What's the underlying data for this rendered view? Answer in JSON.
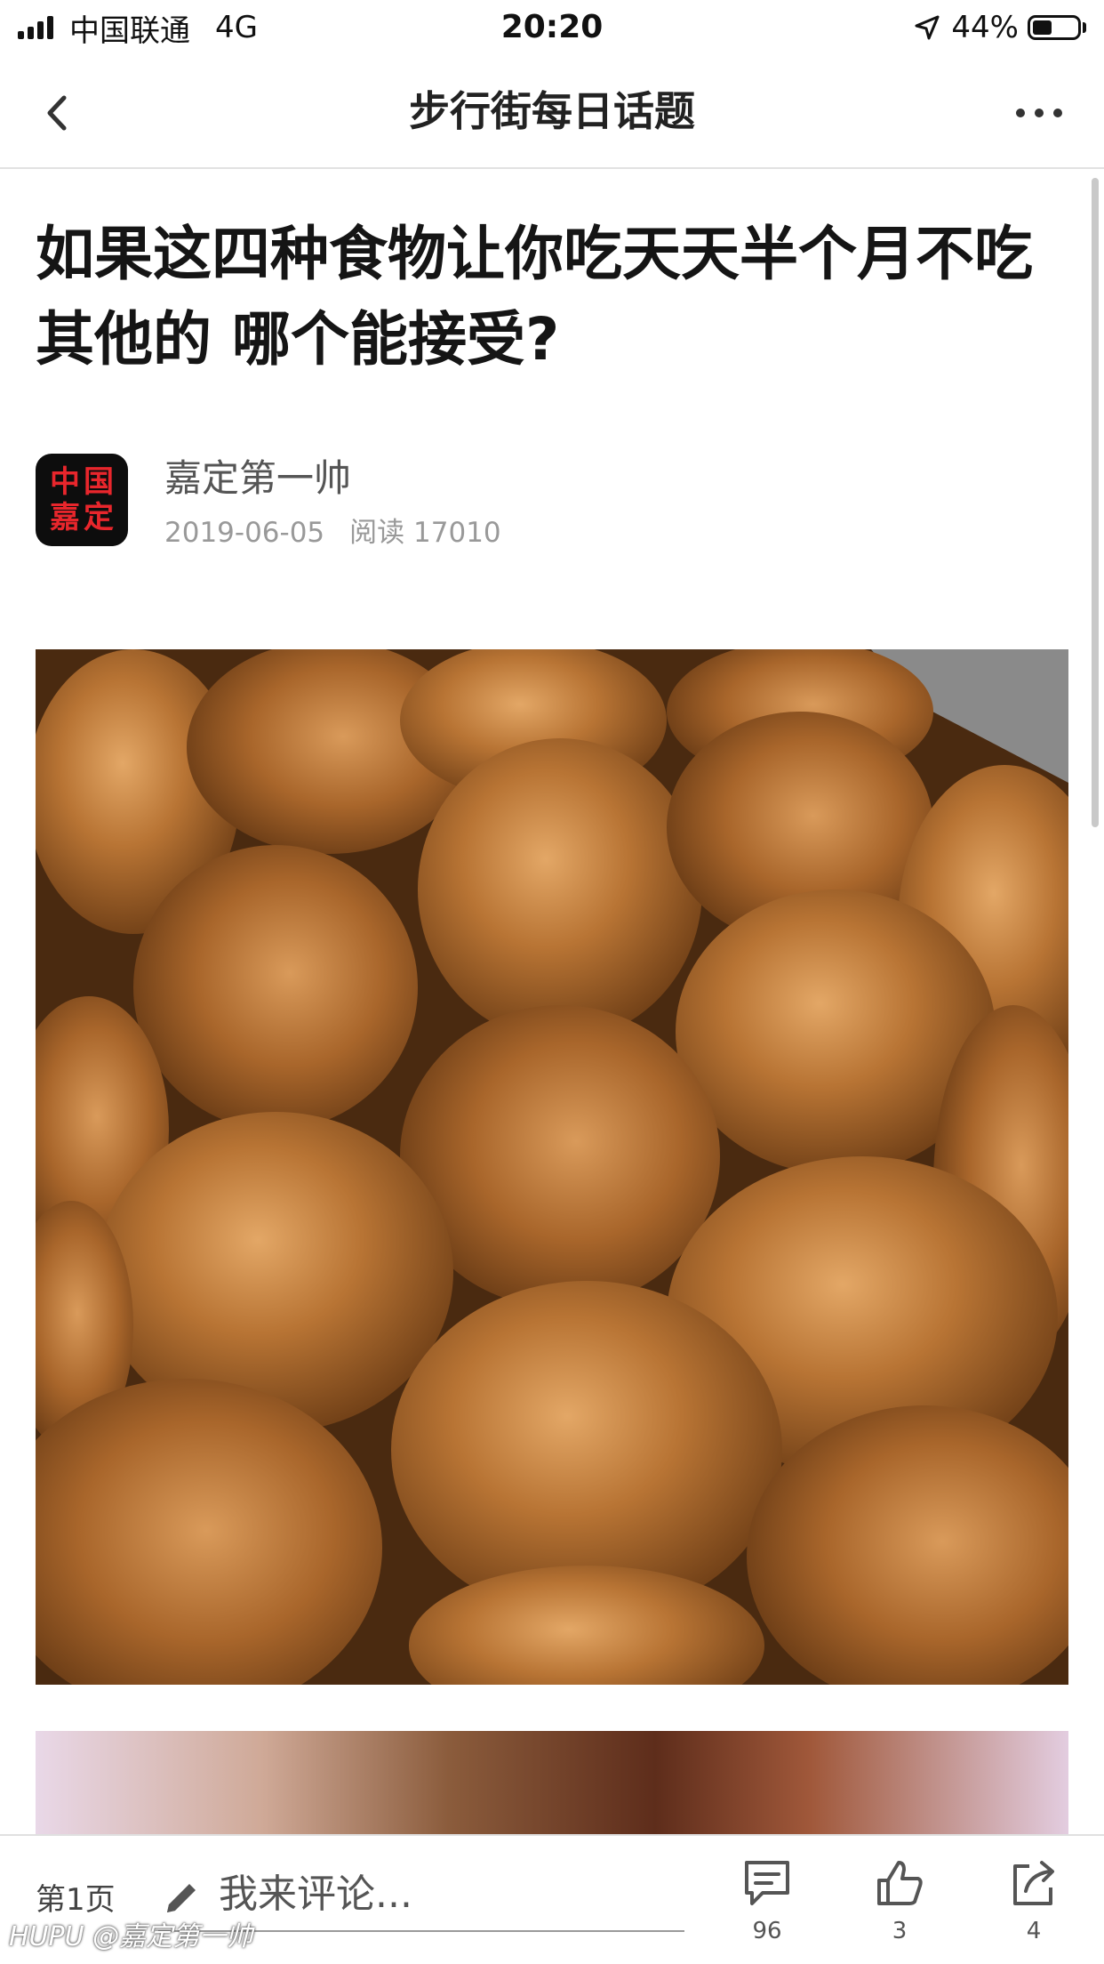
{
  "status_bar": {
    "carrier": "中国联通",
    "network": "4G",
    "time": "20:20",
    "battery_percent": "44%",
    "battery_level": 0.44
  },
  "nav": {
    "title": "步行街每日话题"
  },
  "article": {
    "title": "如果这四种食物让你吃天天半个月不吃其他的 哪个能接受?",
    "author": {
      "name": "嘉定第一帅",
      "avatar_text": [
        "中",
        "国",
        "嘉",
        "定"
      ],
      "date": "2019-06-05",
      "views": "阅读 17010"
    }
  },
  "bottom_bar": {
    "page_label": "第1页",
    "comment_placeholder": "我来评论...",
    "comment_count": "96",
    "like_count": "3",
    "share_count": "4"
  },
  "watermark": "HUPU @嘉定第一帅"
}
